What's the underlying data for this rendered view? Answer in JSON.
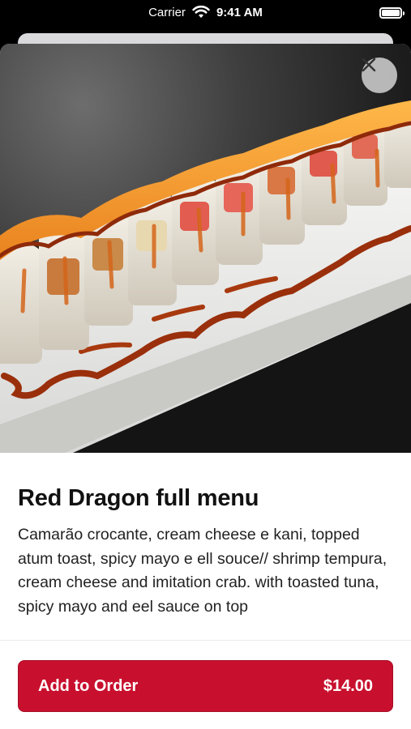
{
  "status_bar": {
    "carrier": "Carrier",
    "time": "9:41 AM"
  },
  "item": {
    "title": "Red Dragon full menu",
    "description": "Camarão crocante, cream cheese e kani, topped atum toast, spicy mayo e ell souce// shrimp tempura, cream cheese and imitation crab. with toasted tuna, spicy mayo and eel sauce on top",
    "image_icon": "sushi-roll-photo"
  },
  "footer": {
    "add_label": "Add to Order",
    "price": "$14.00"
  },
  "colors": {
    "accent": "#c8102e",
    "close_bg": "#cdcdcd"
  }
}
